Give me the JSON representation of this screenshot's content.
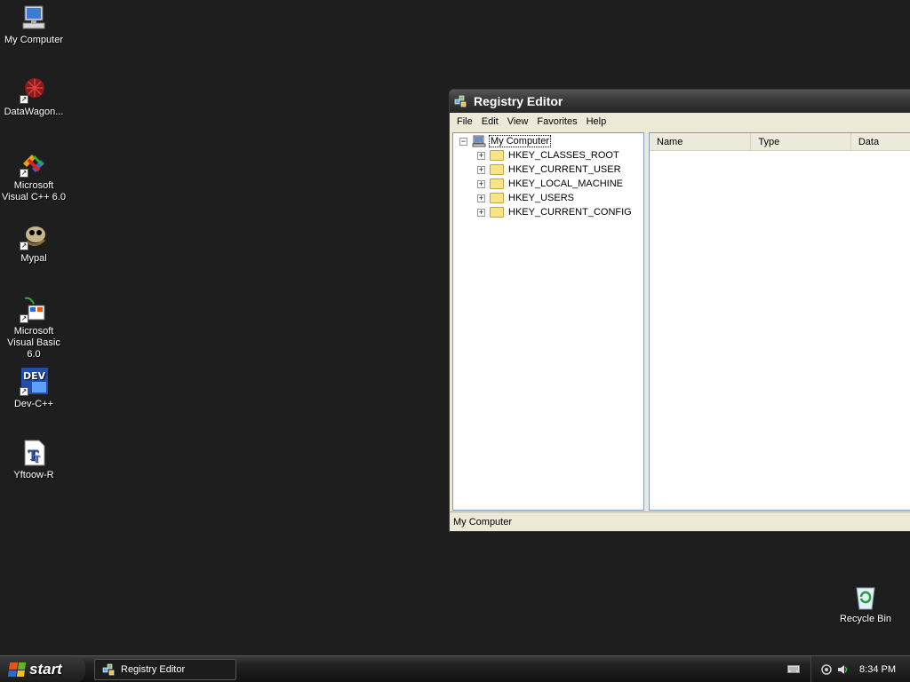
{
  "desktop": {
    "icons": [
      {
        "label": "My Computer",
        "icon": "my-computer-icon"
      },
      {
        "label": "DataWagon...",
        "icon": "datawagon-icon"
      },
      {
        "label": "Microsoft Visual C++ 6.0",
        "icon": "visual-cpp-icon"
      },
      {
        "label": "Mypal",
        "icon": "mypal-icon"
      },
      {
        "label": "Microsoft Visual Basic 6.0",
        "icon": "visual-basic-icon"
      },
      {
        "label": "Dev-C++",
        "icon": "dev-cpp-icon"
      },
      {
        "label": "Yftoow-R",
        "icon": "font-file-icon"
      },
      {
        "label": "Recycle Bin",
        "icon": "recycle-bin-icon"
      }
    ]
  },
  "window": {
    "title": "Registry Editor",
    "menu": [
      "File",
      "Edit",
      "View",
      "Favorites",
      "Help"
    ],
    "tree": {
      "root": "My Computer",
      "keys": [
        "HKEY_CLASSES_ROOT",
        "HKEY_CURRENT_USER",
        "HKEY_LOCAL_MACHINE",
        "HKEY_USERS",
        "HKEY_CURRENT_CONFIG"
      ]
    },
    "list_columns": [
      "Name",
      "Type",
      "Data"
    ],
    "status": "My Computer"
  },
  "taskbar": {
    "start_label": "start",
    "tasks": [
      "Registry Editor"
    ],
    "clock": "8:34 PM"
  },
  "colors": {
    "desktop_bg": "#1e1e1e",
    "taskbar_bg": "#1a1a1a",
    "folder": "#f6e58d"
  }
}
